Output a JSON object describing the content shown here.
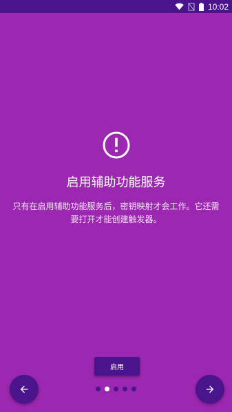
{
  "status_bar": {
    "time": "10:02",
    "icons": [
      "wifi-icon",
      "no-signal-icon",
      "battery-icon"
    ]
  },
  "page": {
    "icon": "alert-circle-icon",
    "title": "启用辅助功能服务",
    "description": "只有在启用辅助功能服务后，密钥映射才会工作。它还需要打开才能创建触发器。"
  },
  "actions": {
    "enable_label": "启用",
    "prev_icon": "arrow-left-icon",
    "next_icon": "arrow-right-icon"
  },
  "pager": {
    "count": 5,
    "active_index": 1
  },
  "colors": {
    "background": "#9c27b0",
    "accent_dark": "#4a148c",
    "text": "#ffffff"
  }
}
